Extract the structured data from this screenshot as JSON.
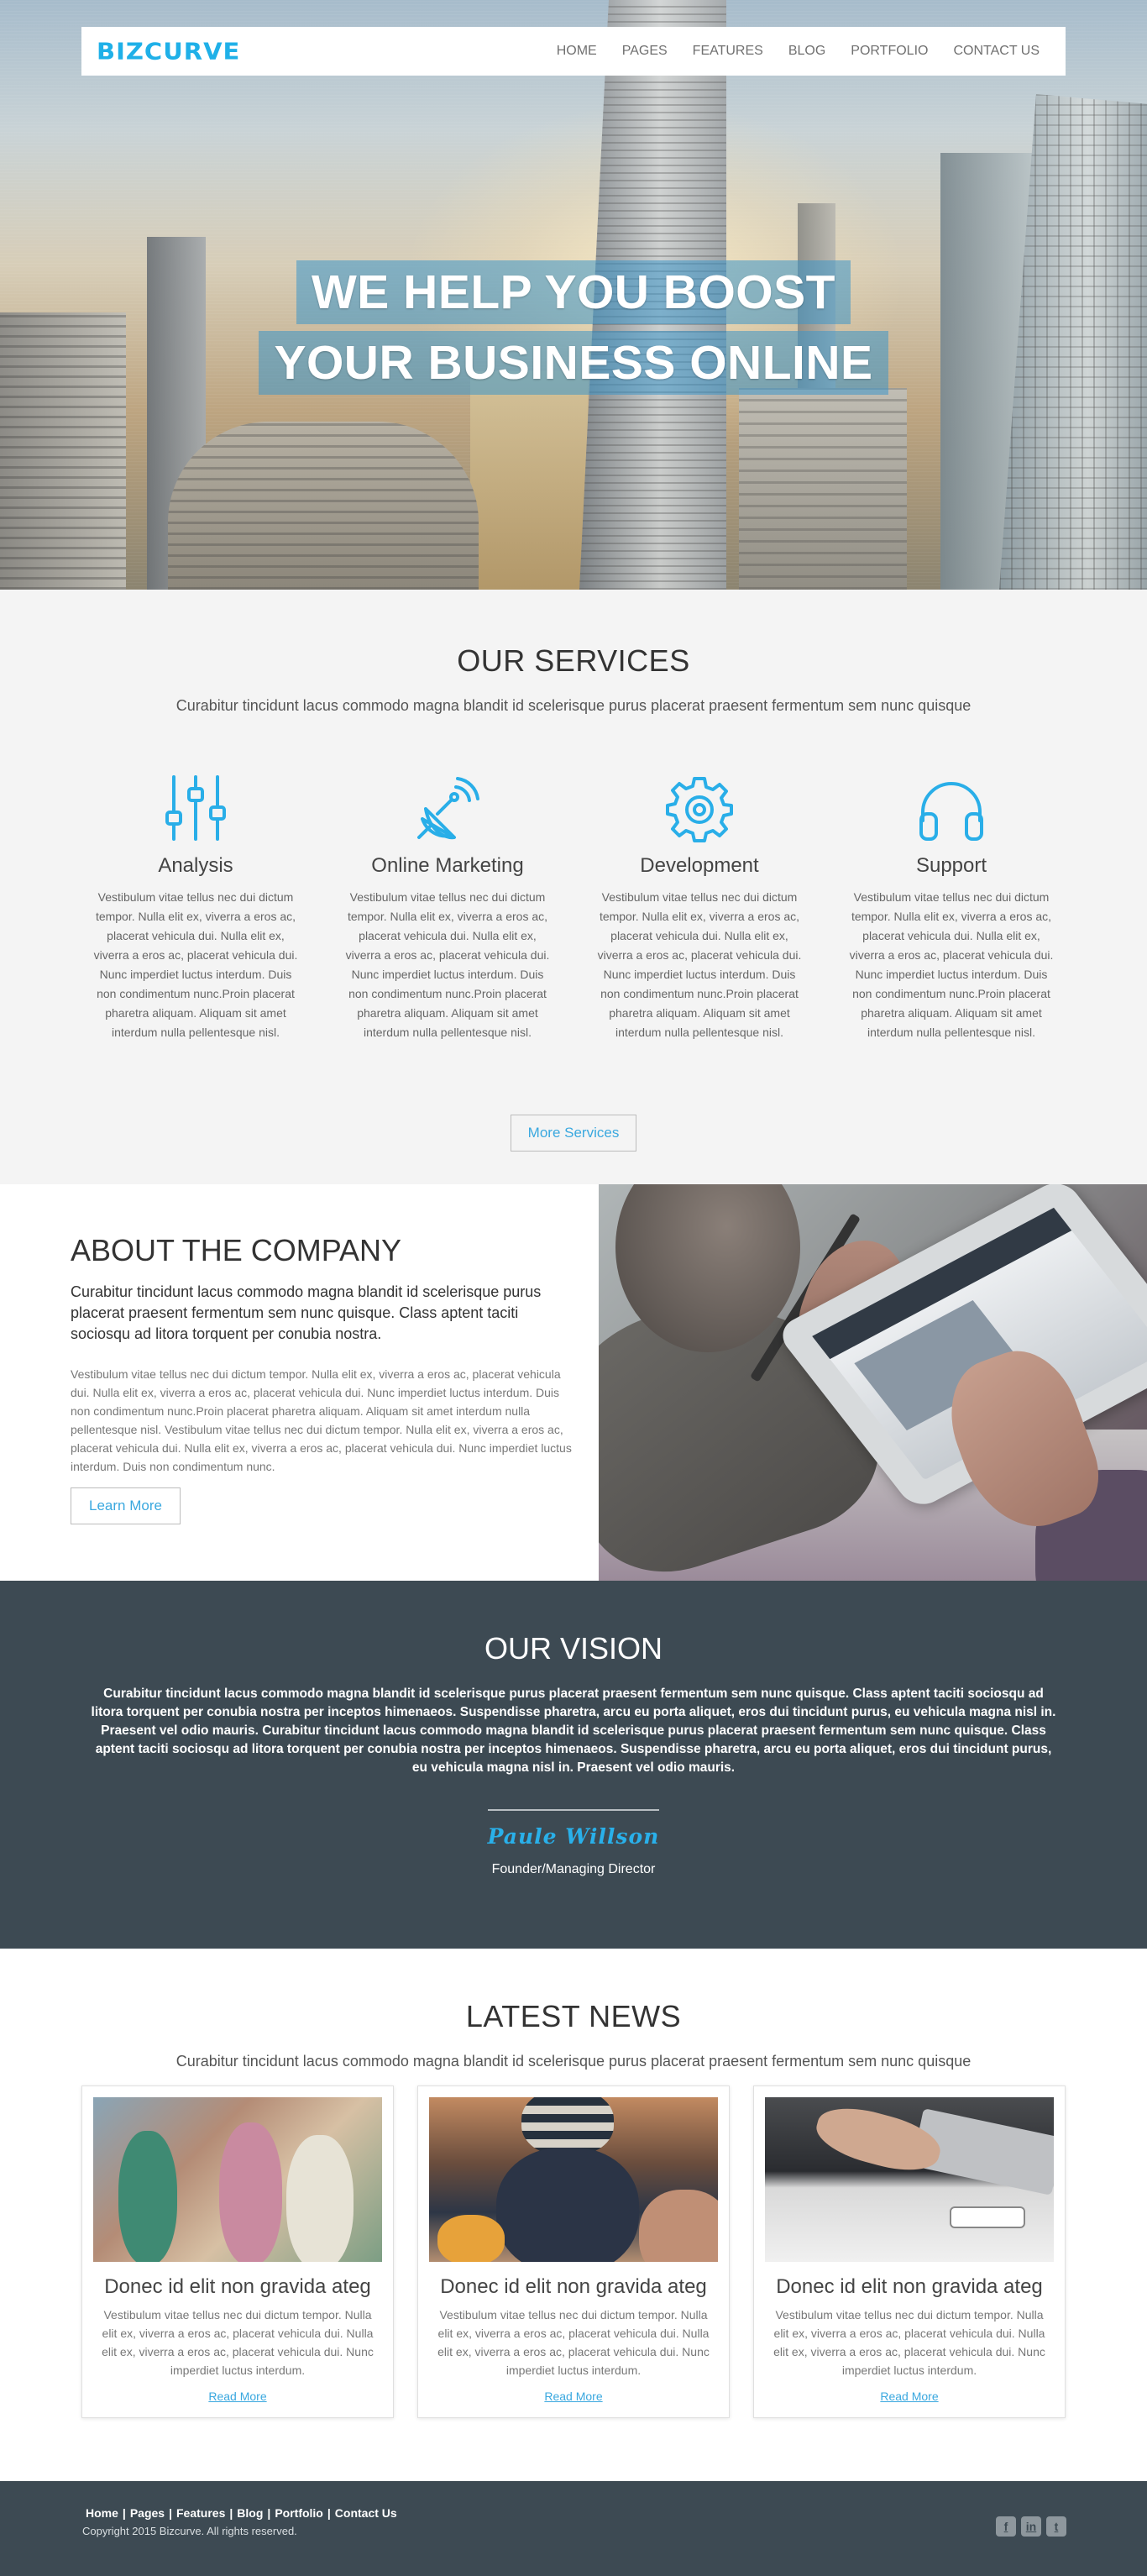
{
  "header": {
    "logo": "BIZCURVE",
    "menu": [
      "HOME",
      "PAGES",
      "FEATURES",
      "BLOG",
      "PORTFOLIO",
      "CONTACT US"
    ]
  },
  "hero": {
    "line1": "WE HELP YOU BOOST",
    "line2": "YOUR BUSINESS ONLINE"
  },
  "services": {
    "title": "OUR SERVICES",
    "subtitle": "Curabitur tincidunt lacus commodo magna blandit id scelerisque purus placerat praesent fermentum sem nunc quisque",
    "items": [
      {
        "name": "Analysis",
        "icon": "sliders-icon",
        "text": "Vestibulum vitae tellus nec dui dictum tempor. Nulla elit ex, viverra a eros ac, placerat vehicula dui. Nulla elit ex, viverra a eros ac, placerat vehicula dui. Nunc imperdiet luctus interdum. Duis non condimentum nunc.Proin placerat pharetra aliquam. Aliquam sit amet interdum nulla pellentesque nisl."
      },
      {
        "name": "Online Marketing",
        "icon": "satellite-dish-icon",
        "text": "Vestibulum vitae tellus nec dui dictum tempor. Nulla elit ex, viverra a eros ac, placerat vehicula dui. Nulla elit ex, viverra a eros ac, placerat vehicula dui. Nunc imperdiet luctus interdum. Duis non condimentum nunc.Proin placerat pharetra aliquam. Aliquam sit amet interdum nulla pellentesque nisl."
      },
      {
        "name": "Development",
        "icon": "gear-icon",
        "text": "Vestibulum vitae tellus nec dui dictum tempor. Nulla elit ex, viverra a eros ac, placerat vehicula dui. Nulla elit ex, viverra a eros ac, placerat vehicula dui. Nunc imperdiet luctus interdum. Duis non condimentum nunc.Proin placerat pharetra aliquam. Aliquam sit amet interdum nulla pellentesque nisl."
      },
      {
        "name": "Support",
        "icon": "headphones-icon",
        "text": "Vestibulum vitae tellus nec dui dictum tempor. Nulla elit ex, viverra a eros ac, placerat vehicula dui. Nulla elit ex, viverra a eros ac, placerat vehicula dui. Nunc imperdiet luctus interdum. Duis non condimentum nunc.Proin placerat pharetra aliquam. Aliquam sit amet interdum nulla pellentesque nisl."
      }
    ],
    "button": "More Services"
  },
  "about": {
    "title": "ABOUT THE COMPANY",
    "lead": "Curabitur tincidunt lacus commodo magna blandit id scelerisque purus placerat praesent fermentum sem nunc quisque. Class aptent taciti sociosqu ad litora torquent per conubia nostra.",
    "body": "Vestibulum vitae tellus nec dui dictum tempor. Nulla elit ex, viverra a eros ac, placerat vehicula dui. Nulla elit ex, viverra a eros ac, placerat vehicula dui. Nunc imperdiet luctus interdum. Duis non condimentum nunc.Proin placerat pharetra aliquam. Aliquam sit amet interdum nulla pellentesque nisl. Vestibulum vitae tellus nec dui dictum tempor. Nulla elit ex, viverra a eros ac, placerat vehicula dui. Nulla elit ex, viverra a eros ac, placerat vehicula dui. Nunc imperdiet luctus interdum. Duis non condimentum nunc.",
    "button": "Learn More"
  },
  "vision": {
    "title": "OUR VISION",
    "text": "Curabitur tincidunt lacus commodo magna blandit id scelerisque purus placerat praesent fermentum sem nunc quisque. Class aptent taciti sociosqu ad litora torquent per conubia nostra per inceptos himenaeos. Suspendisse pharetra, arcu eu porta aliquet, eros dui tincidunt purus, eu vehicula magna nisl in. Praesent vel odio mauris. Curabitur tincidunt lacus commodo magna blandit id scelerisque purus placerat praesent fermentum sem nunc quisque. Class aptent taciti sociosqu ad litora torquent per conubia nostra per inceptos himenaeos. Suspendisse pharetra, arcu eu porta aliquet, eros dui tincidunt purus, eu vehicula magna nisl in. Praesent vel odio mauris.",
    "signature": "Paule Willson",
    "role": "Founder/Managing Director"
  },
  "news": {
    "title": "LATEST NEWS",
    "subtitle": "Curabitur tincidunt lacus commodo magna blandit id scelerisque purus placerat praesent fermentum sem nunc quisque",
    "items": [
      {
        "title": "Donec id elit non gravida ateg",
        "text": "Vestibulum vitae tellus nec dui dictum tempor. Nulla elit ex, viverra a eros ac, placerat vehicula dui. Nulla elit ex, viverra a eros ac, placerat vehicula dui. Nunc imperdiet luctus interdum.",
        "link": "Read More"
      },
      {
        "title": "Donec id elit non gravida ateg",
        "text": "Vestibulum vitae tellus nec dui dictum tempor. Nulla elit ex, viverra a eros ac, placerat vehicula dui. Nulla elit ex, viverra a eros ac, placerat vehicula dui. Nunc imperdiet luctus interdum.",
        "link": "Read More"
      },
      {
        "title": "Donec id elit non gravida ateg",
        "text": "Vestibulum vitae tellus nec dui dictum tempor. Nulla elit ex, viverra a eros ac, placerat vehicula dui. Nulla elit ex, viverra a eros ac, placerat vehicula dui. Nunc imperdiet luctus interdum.",
        "link": "Read More"
      }
    ]
  },
  "footer": {
    "links": [
      "Home",
      "Pages",
      "Features",
      "Blog",
      "Portfolio",
      "Contact Us"
    ],
    "copyright": "Copyright 2015 Bizcurve. All rights reserved.",
    "socials": [
      {
        "icon": "facebook-icon",
        "glyph": "f"
      },
      {
        "icon": "linkedin-icon",
        "glyph": "in"
      },
      {
        "icon": "twitter-icon",
        "glyph": "t"
      }
    ]
  },
  "colors": {
    "accent": "#1fb0e8",
    "dark_band": "#3d4a53",
    "services_bg": "#f4f4f4"
  }
}
